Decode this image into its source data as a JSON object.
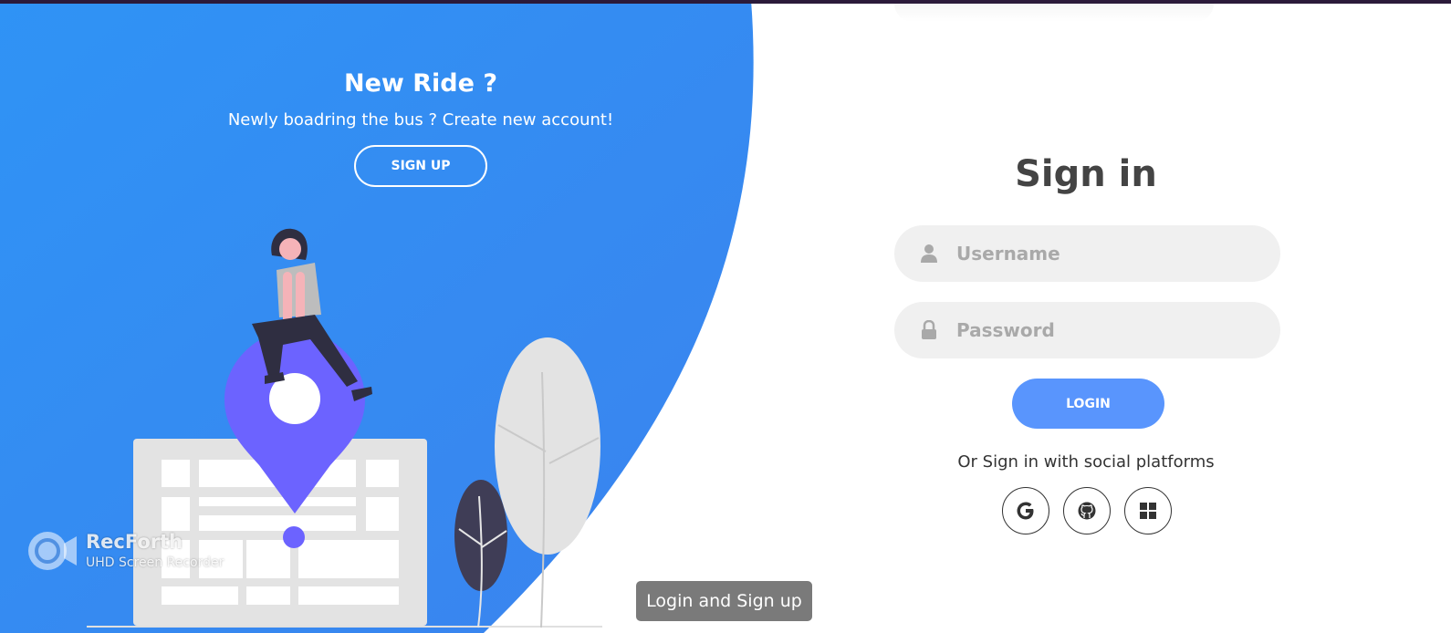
{
  "signup_panel": {
    "title": "New Ride ?",
    "subtitle": "Newly boadring the bus ? Create new account!",
    "signup_button": "SIGN UP"
  },
  "signin_form": {
    "title": "Sign in",
    "username_placeholder": "Username",
    "password_placeholder": "Password",
    "login_button": "LOGIN",
    "social_text": "Or Sign in with social platforms",
    "social_icons": [
      "google-icon",
      "github-icon",
      "windows-icon"
    ]
  },
  "tooltip": {
    "text": "Login and Sign up"
  },
  "watermark": {
    "name": "RecForth",
    "tagline": "UHD Screen Recorder"
  },
  "colors": {
    "panel_blue_start": "#2f93f5",
    "panel_blue_end": "#3b83ee",
    "login_button": "#5995fd",
    "pin_purple": "#6c63ff",
    "input_background": "#f0f0f0"
  }
}
